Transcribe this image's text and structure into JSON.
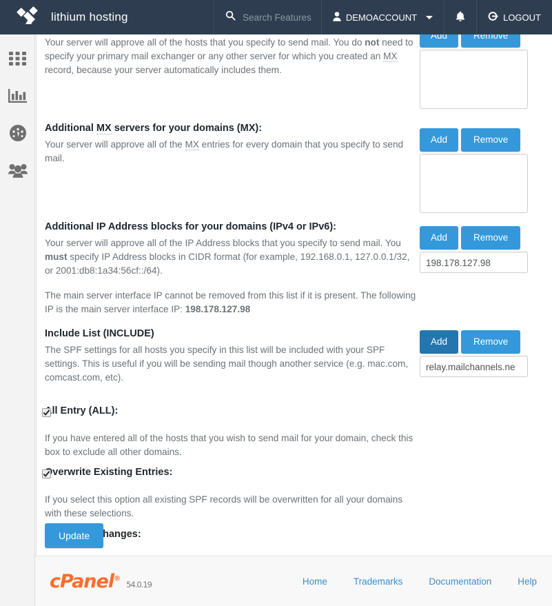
{
  "header": {
    "brand_name": "lithium hosting",
    "logo_icon": "lithium-logo-icon",
    "search_icon": "search-icon",
    "search_placeholder": "Search Features",
    "account_icon": "user-icon",
    "account_label": "DEMOACCOUNT",
    "caret_icon": "chevron-down-icon",
    "notifications_icon": "bell-icon",
    "logout_icon": "logout-icon",
    "logout_label": "LOGOUT",
    "background_color": "#2e3e50"
  },
  "sidebar": {
    "items": [
      {
        "name": "apps-grid-icon",
        "label": "Apps"
      },
      {
        "name": "bar-chart-icon",
        "label": "Statistics"
      },
      {
        "name": "gauge-icon",
        "label": "Dashboard"
      },
      {
        "name": "users-icon",
        "label": "User Manager"
      }
    ]
  },
  "main": {
    "intro": {
      "text_1": "Your server will approve all of the hosts that you specify to send mail. You do ",
      "bold_1": "not",
      "text_2": " need to specify your primary mail exchanger or any other server for which you created an ",
      "abbr_1": "MX",
      "text_3": " record, because your server automatically includes them."
    },
    "sections": [
      {
        "key": "hosts",
        "add_label": "Add",
        "remove_label": "Remove",
        "list_values": []
      },
      {
        "key": "mx",
        "title_1": "Additional ",
        "title_abbr": "MX",
        "title_2": " servers for your domains (MX):",
        "desc_1": "Your server will approve all of the ",
        "desc_abbr": "MX",
        "desc_2": " entries for every domain that you specify to send mail.",
        "add_label": "Add",
        "remove_label": "Remove",
        "list_values": []
      },
      {
        "key": "ip",
        "title": "Additional IP Address blocks for your domains (IPv4 or IPv6):",
        "desc_1": "Your server will approve all of the IP Address blocks that you specify to send mail. You ",
        "desc_bold": "must",
        "desc_2": " specify IP Address blocks in CIDR format (for example, 192.168.0.1, 127.0.0.1/32, or 2001:db8:1a34:56cf::/64).",
        "note_1": "The main server interface IP cannot be removed from this list if it is present. The following IP is the main server interface IP: ",
        "note_ip": "198.178.127.98",
        "add_label": "Add",
        "remove_label": "Remove",
        "list_values": [
          "198.178.127.98"
        ]
      },
      {
        "key": "include",
        "title": "Include List (INCLUDE)",
        "desc": "The SPF settings for all hosts you specify in this list will be included with your SPF settings. This is useful if you will be sending mail though another service (e.g. mac.com, comcast.com, etc).",
        "add_label": "Add",
        "remove_label": "Remove",
        "add_button_state": "active",
        "list_values": [
          "relay.mailchannels.ne"
        ]
      }
    ],
    "all_entry": {
      "title": "All Entry (ALL):",
      "desc": "If you have entered all of the hosts that you wish to send mail for your domain, check this box to exclude all other domains.",
      "checked": true
    },
    "overwrite": {
      "title": "Overwrite Existing Entries:",
      "desc": "If you select this option all existing SPF records will be overwritten for all your domains with these selections.",
      "checked": true
    },
    "save": {
      "title": "Save Your Changes:",
      "button_label": "Update"
    }
  },
  "footer": {
    "logo_text": "cPanel",
    "registered_mark": "®",
    "version": "54.0.19",
    "links": [
      "Home",
      "Trademarks",
      "Documentation",
      "Help"
    ]
  },
  "colors": {
    "header_bg": "#2e3e50",
    "button_blue": "#3498db",
    "button_blue_active": "#2476ae",
    "link_blue": "#3d8ecc",
    "cpanel_orange": "#ff6c2c"
  }
}
